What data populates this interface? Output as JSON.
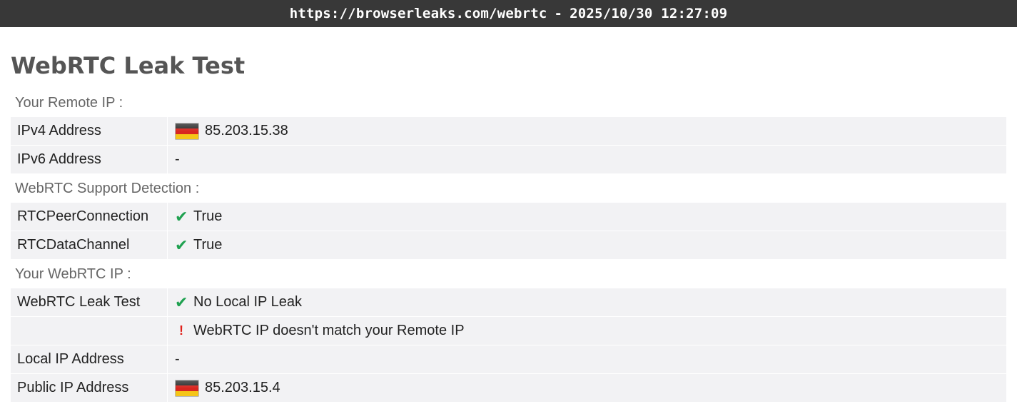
{
  "header": {
    "url": "https://browserleaks.com/webrtc",
    "separator": "-",
    "timestamp": "2025/10/30 12:27:09"
  },
  "page_title": "WebRTC Leak Test",
  "sections": {
    "remote_ip": {
      "label": "Your Remote IP :",
      "ipv4": {
        "key": "IPv4 Address",
        "value": "85.203.15.38",
        "flag": "germany-flag-icon"
      },
      "ipv6": {
        "key": "IPv6 Address",
        "value": "-"
      }
    },
    "support": {
      "label": "WebRTC Support Detection :",
      "peer": {
        "key": "RTCPeerConnection",
        "value": "True",
        "icon": "check-icon"
      },
      "data_channel": {
        "key": "RTCDataChannel",
        "value": "True",
        "icon": "check-icon"
      }
    },
    "webrtc_ip": {
      "label": "Your WebRTC IP :",
      "leak_test": {
        "key": "WebRTC Leak Test",
        "result1": "No Local IP Leak",
        "result2": "WebRTC IP doesn't match your Remote IP",
        "check_glyph": "✔",
        "warn_glyph": "!"
      },
      "local_ip": {
        "key": "Local IP Address",
        "value": "-"
      },
      "public_ip": {
        "key": "Public IP Address",
        "value": "85.203.15.4",
        "flag": "germany-flag-icon"
      }
    }
  },
  "colors": {
    "topbar": "#383838",
    "row_bg": "#f2f2f4",
    "check": "#1fa150",
    "warn": "#e0201a",
    "title": "#555555"
  },
  "icons": {
    "check": "✔",
    "warn": "!"
  }
}
